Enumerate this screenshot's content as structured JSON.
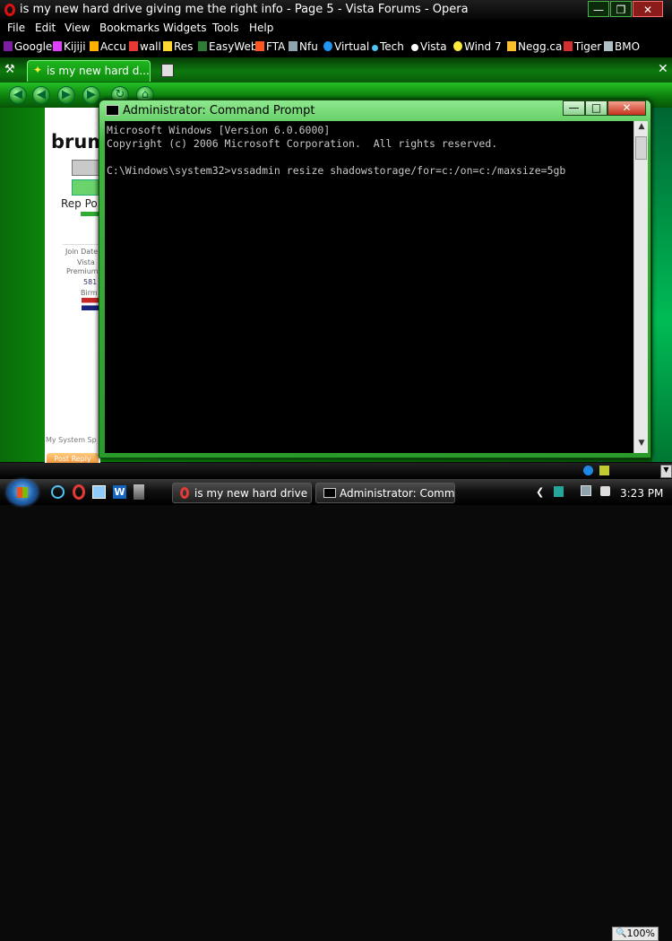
{
  "browser": {
    "window_title": "is my new hard drive giving me the right info - Page 5 - Vista Forums - Opera",
    "menu": [
      "File",
      "Edit",
      "View",
      "Bookmarks",
      "Widgets",
      "Tools",
      "Help"
    ],
    "bookmarks": [
      {
        "label": "Google",
        "icon": "yahoo-icon"
      },
      {
        "label": "Kijiji",
        "icon": "kijiji-icon"
      },
      {
        "label": "Accu",
        "icon": "accuweather-icon"
      },
      {
        "label": "wall",
        "icon": "wall-icon"
      },
      {
        "label": "Res",
        "icon": "res-icon"
      },
      {
        "label": "EasyWeb",
        "icon": "td-icon"
      },
      {
        "label": "FTA",
        "icon": "fta-icon"
      },
      {
        "label": "Nfu",
        "icon": "nfu-icon"
      },
      {
        "label": "Virtual",
        "icon": "virtual-icon"
      },
      {
        "label": "Tech",
        "icon": "tech-icon"
      },
      {
        "label": "Vista",
        "icon": "vista-icon"
      },
      {
        "label": "Wind 7",
        "icon": "wind7-icon"
      },
      {
        "label": "Negg.ca",
        "icon": "newegg-icon"
      },
      {
        "label": "Tiger",
        "icon": "tiger-icon"
      },
      {
        "label": "BMO",
        "icon": "bmo-icon"
      }
    ],
    "tab_label": "is my new hard d...",
    "zoom": "100%",
    "page_fragments": {
      "username": "brum",
      "rep_label": "Rep Po",
      "join_date": "Join Date",
      "os": "Vista",
      "edition": "Premium",
      "posts": "581",
      "location": "Birm",
      "system_spec": "My System Sp",
      "post_reply": "Post Reply"
    }
  },
  "cmd": {
    "title": "Administrator: Command Prompt",
    "lines": [
      "Microsoft Windows [Version 6.0.6000]",
      "Copyright (c) 2006 Microsoft Corporation.  All rights reserved.",
      "",
      "C:\\Windows\\system32>vssadmin resize shadowstorage/for=c:/on=c:/maxsize=5gb"
    ]
  },
  "taskbar": {
    "items": [
      {
        "label": "is my new hard drive ..."
      },
      {
        "label": "Administrator: Comm..."
      }
    ],
    "clock": "3:23 PM"
  }
}
